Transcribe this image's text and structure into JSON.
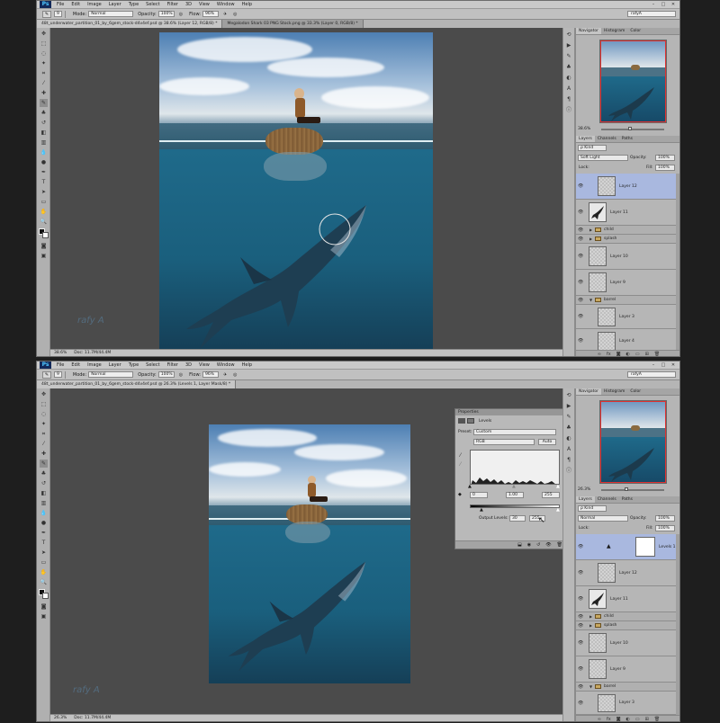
{
  "app": {
    "logo": "Ps",
    "menu": [
      "File",
      "Edit",
      "Image",
      "Layer",
      "Type",
      "Select",
      "Filter",
      "3D",
      "View",
      "Window",
      "Help"
    ],
    "window_controls": [
      "–",
      "□",
      "✕"
    ],
    "workspace": "rafyA"
  },
  "options": {
    "brush_size": "9",
    "mode_label": "Mode:",
    "mode_value": "Normal",
    "opacity_label": "Opacity:",
    "opacity_value": "100%",
    "flow_label": "Flow:",
    "flow_value": "96%"
  },
  "top": {
    "tabs": [
      "48t_underwater_partition_01_by_6gem_stock-d4v4ef.psd @ 38.6% (Layer 12, RGB/8) *",
      "Megalodon Shark 03 PNG Stock.png @ 33.3% (Layer 0, RGB/8) *"
    ],
    "zoom": "38.6%",
    "doc_info": "Doc: 11.7M/44.4M",
    "nav_zoom": "38.6%",
    "panel_tabs": [
      "Navigator",
      "Histogram",
      "Color"
    ],
    "layer_tabs": [
      "Layers",
      "Channels",
      "Paths"
    ],
    "kind": "ρ Kind",
    "blend": "Soft Light",
    "opacity_label": "Opacity:",
    "opacity": "100%",
    "lock_label": "Lock:",
    "fill_label": "Fill:",
    "fill": "100%",
    "layers": [
      {
        "name": "Layer 12",
        "type": "layer",
        "selected": true
      },
      {
        "name": "Layer 11",
        "type": "layer"
      },
      {
        "name": "child",
        "type": "group"
      },
      {
        "name": "splash",
        "type": "group"
      },
      {
        "name": "Layer 10",
        "type": "layer"
      },
      {
        "name": "Layer 9",
        "type": "layer"
      },
      {
        "name": "barrel",
        "type": "group-open"
      },
      {
        "name": "Layer 3",
        "type": "layer"
      },
      {
        "name": "Layer 4",
        "type": "layer"
      }
    ]
  },
  "bottom": {
    "tabs": [
      "48t_underwater_partition_01_by_6gem_stock-d4v4ef.psd @ 26.3% (Levels 1, Layer Mask/8) *"
    ],
    "zoom": "26.3%",
    "doc_info": "Doc: 11.7M/44.4M",
    "nav_zoom": "26.3%",
    "panel_tabs": [
      "Navigator",
      "Histogram",
      "Color"
    ],
    "layer_tabs": [
      "Layers",
      "Channels",
      "Paths"
    ],
    "kind": "ρ Kind",
    "blend": "Normal",
    "opacity_label": "Opacity:",
    "opacity": "100%",
    "lock_label": "Lock:",
    "fill_label": "Fill:",
    "fill": "100%",
    "layers": [
      {
        "name": "Levels 1",
        "type": "adjustment",
        "selected": true
      },
      {
        "name": "Layer 12",
        "type": "layer"
      },
      {
        "name": "Layer 11",
        "type": "layer"
      },
      {
        "name": "child",
        "type": "group"
      },
      {
        "name": "splash",
        "type": "group"
      },
      {
        "name": "Layer 10",
        "type": "layer"
      },
      {
        "name": "Layer 9",
        "type": "layer"
      },
      {
        "name": "barrel",
        "type": "group-open"
      },
      {
        "name": "Layer 3",
        "type": "layer"
      }
    ],
    "properties": {
      "title": "Properties",
      "section": "Levels",
      "preset_label": "Preset:",
      "preset": "Custom",
      "channel": "RGB",
      "auto": "Auto",
      "input_black": "0",
      "input_gray": "1.00",
      "input_white": "255",
      "output_label": "Output Levels:",
      "output_black": "30",
      "output_white": "255"
    }
  },
  "watermark": "rafy A"
}
